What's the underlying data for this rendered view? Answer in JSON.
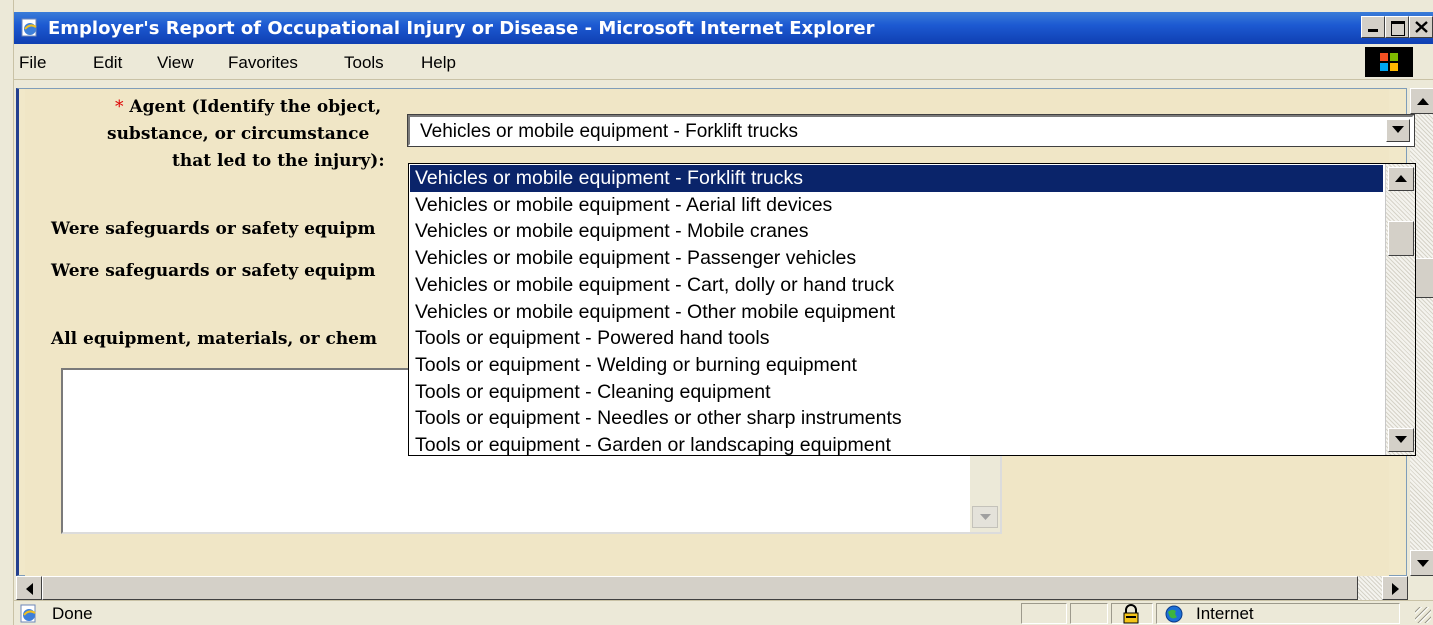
{
  "window": {
    "title": "Employer's Report of Occupational Injury or Disease - Microsoft Internet Explorer"
  },
  "menu": [
    "File",
    "Edit",
    "View",
    "Favorites",
    "Tools",
    "Help"
  ],
  "form": {
    "required_marker": "*",
    "agent_label_lines": [
      "Agent (Identify the object,",
      "substance, or circumstance",
      "that led to the injury):"
    ],
    "question_1": "Were safeguards or safety equipm",
    "question_2": "Were safeguards or safety equipm",
    "question_3": "All equipment, materials, or chem",
    "agent_select": {
      "selected_value": "Vehicles or mobile equipment - Forklift trucks",
      "options": [
        "Vehicles or mobile equipment - Forklift trucks",
        "Vehicles or mobile equipment - Aerial lift devices",
        "Vehicles or mobile equipment - Mobile cranes",
        "Vehicles or mobile equipment - Passenger vehicles",
        "Vehicles or mobile equipment - Cart, dolly or hand truck",
        "Vehicles or mobile equipment - Other mobile equipment",
        "Tools or equipment - Powered hand tools",
        "Tools or equipment - Welding or burning equipment",
        "Tools or equipment - Cleaning equipment",
        "Tools or equipment - Needles or other sharp instruments",
        "Tools or equipment - Garden or landscaping equipment"
      ],
      "highlighted_index": 0
    }
  },
  "status": {
    "text": "Done",
    "zone": "Internet"
  },
  "icons": {
    "title": "ie-page-icon",
    "status": "ie-page-icon",
    "lock": "padlock-icon",
    "zone": "globe-icon",
    "brand": "windows-flag-icon"
  },
  "colors": {
    "titlebar": "#0f3fb2",
    "selection": "#0a246a",
    "page_background": "#f0e6c6",
    "required": "#dd0000"
  }
}
